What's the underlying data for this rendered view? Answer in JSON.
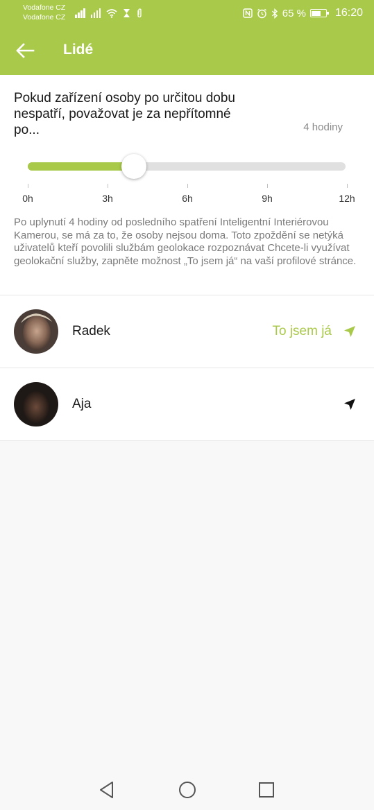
{
  "status_bar": {
    "carrier_1": "Vodafone CZ",
    "carrier_2": "Vodafone CZ",
    "battery_percent_label": "65 %",
    "battery_level": 0.65,
    "time": "16:20"
  },
  "app_bar": {
    "title": "Lidé",
    "color": "#a9c94a"
  },
  "absence_setting": {
    "question": "Pokud zařízení osoby po určitou dobu nespatří, považovat je za nepřítomné po...",
    "value_label": "4 hodiny",
    "slider": {
      "min_hours": 0,
      "max_hours": 12,
      "value_hours": 4
    },
    "tick_labels": [
      "0h",
      "3h",
      "6h",
      "9h",
      "12h"
    ],
    "description": "Po uplynutí 4 hodiny od posledního spatření Inteligentní Interiérovou Kamerou, se má za to, že osoby nejsou doma. Toto zpoždění se netýká uživatelů kteří povolili službám geolokace rozpoznávat Chcete-li využívat geolokační služby, zapněte možnost „To jsem já“ na vaší profilové stránce."
  },
  "people": [
    {
      "name": "Radek",
      "me_label": "To jsem já",
      "location_icon": "navigation-arrow-icon",
      "icon_color": "#a9c94a"
    },
    {
      "name": "Aja",
      "me_label": "",
      "location_icon": "navigation-arrow-icon",
      "icon_color": "#111111"
    }
  ],
  "nav_bar": {
    "icons": [
      "back-triangle-icon",
      "home-circle-icon",
      "recents-square-icon"
    ]
  }
}
